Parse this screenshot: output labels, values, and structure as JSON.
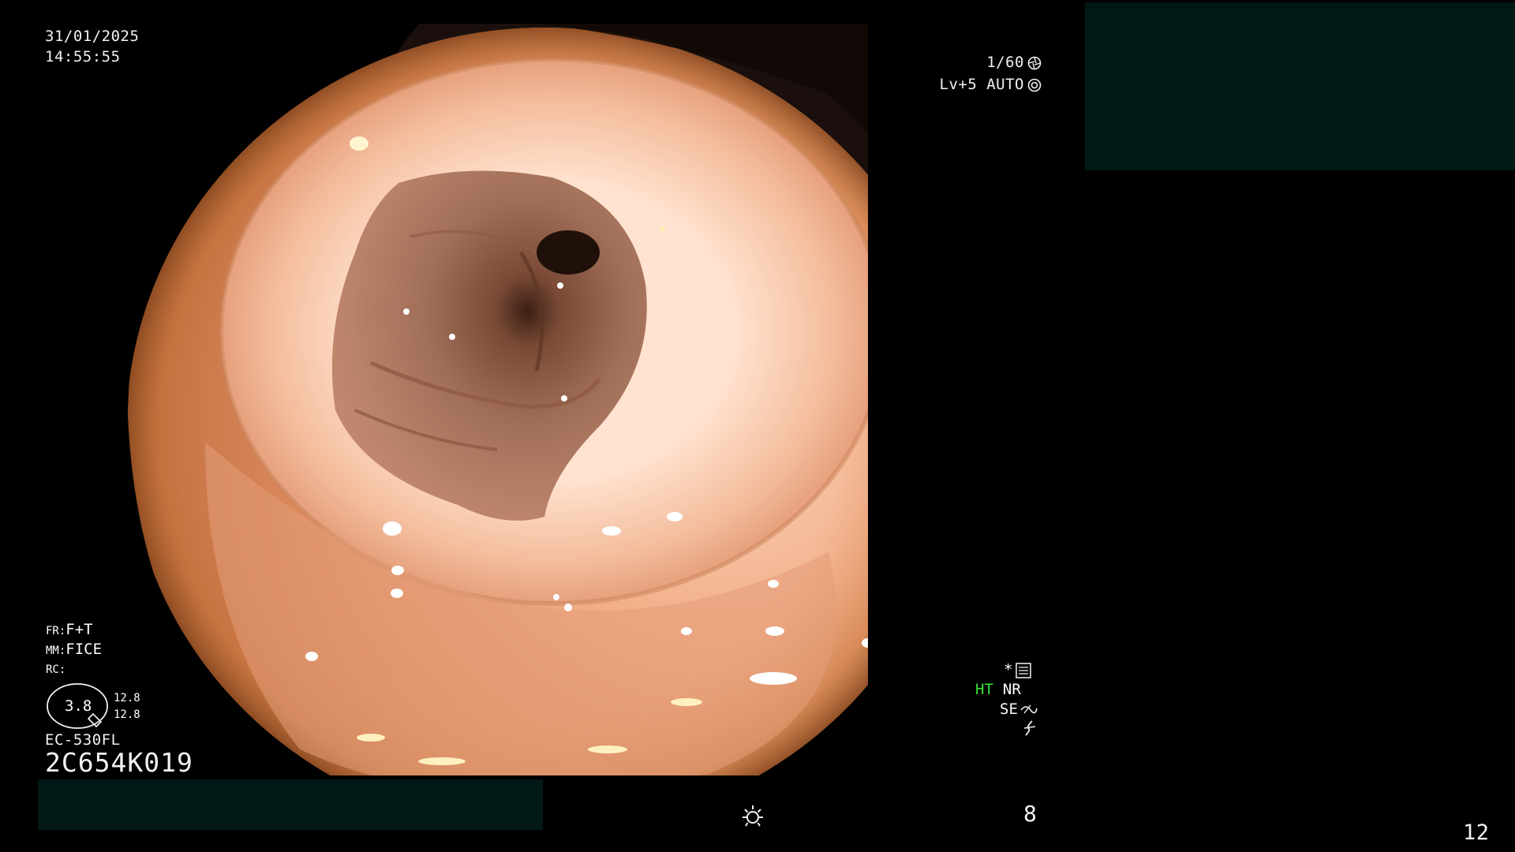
{
  "osd_top_left": {
    "date": "31/01/2025",
    "time": "14:55:55"
  },
  "osd_top_right": {
    "shutter": "1/60",
    "level": "Lv+5 AUTO"
  },
  "osd_bottom_left": {
    "fr_label": "FR:",
    "fr_value": "F+T",
    "mm_label": "MM:",
    "mm_value": "FICE",
    "rc_label": "RC:",
    "zoom_value": "3.8",
    "zoom_top": "12.8",
    "zoom_bottom": "12.8",
    "scope_model": "EC-530FL",
    "serial": "2C654K019"
  },
  "osd_bottom_right": {
    "star": "*",
    "ht": "HT",
    "nr": "NR",
    "se": "SE"
  },
  "status_bar": {
    "brightness_value": "8"
  },
  "frame_number": "12",
  "colors": {
    "background": "#000000",
    "redaction": "#011816",
    "ht_indicator": "#39e239",
    "text": "#f2f2f2"
  },
  "icons": [
    "shutter-icon",
    "auto-iris-icon",
    "menu-grid-icon",
    "enhance-curve-icon",
    "flash-icon",
    "brightness-sun-icon"
  ]
}
